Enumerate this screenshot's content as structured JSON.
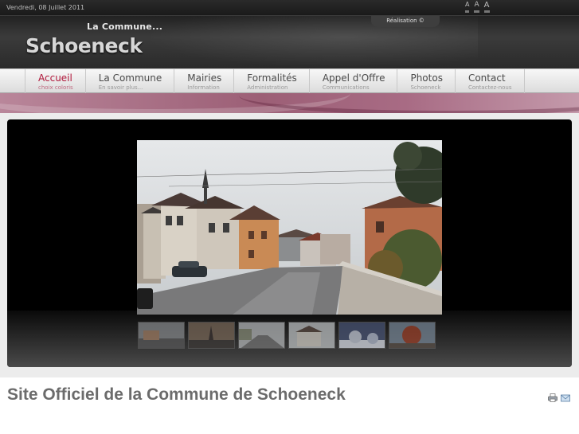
{
  "topbar": {
    "date": "Vendredi, 08 Juillet 2011",
    "font_sizes": [
      "A",
      "A",
      "A"
    ]
  },
  "header": {
    "realisation": "Réalisation ©",
    "logo_small": "La Commune...",
    "logo_big": "Schoeneck"
  },
  "nav": {
    "items": [
      {
        "label": "Accueil",
        "sub": "choix coloris"
      },
      {
        "label": "La Commune",
        "sub": "En savoir plus..."
      },
      {
        "label": "Mairies",
        "sub": "Information"
      },
      {
        "label": "Formalités",
        "sub": "Administration"
      },
      {
        "label": "Appel d'Offre",
        "sub": "Communications"
      },
      {
        "label": "Photos",
        "sub": "Schoeneck"
      },
      {
        "label": "Contact",
        "sub": "Contactez-nous"
      }
    ]
  },
  "slideshow": {
    "thumbnails": [
      "street",
      "church-dusk",
      "road",
      "house",
      "snow",
      "autumn-tree"
    ]
  },
  "page": {
    "title": "Site Officiel de la Commune de Schoeneck",
    "icons": [
      "print-icon",
      "email-icon"
    ]
  },
  "colors": {
    "accent": "#b0173a",
    "band": "#9c5f76",
    "title": "#6b6b6b"
  }
}
